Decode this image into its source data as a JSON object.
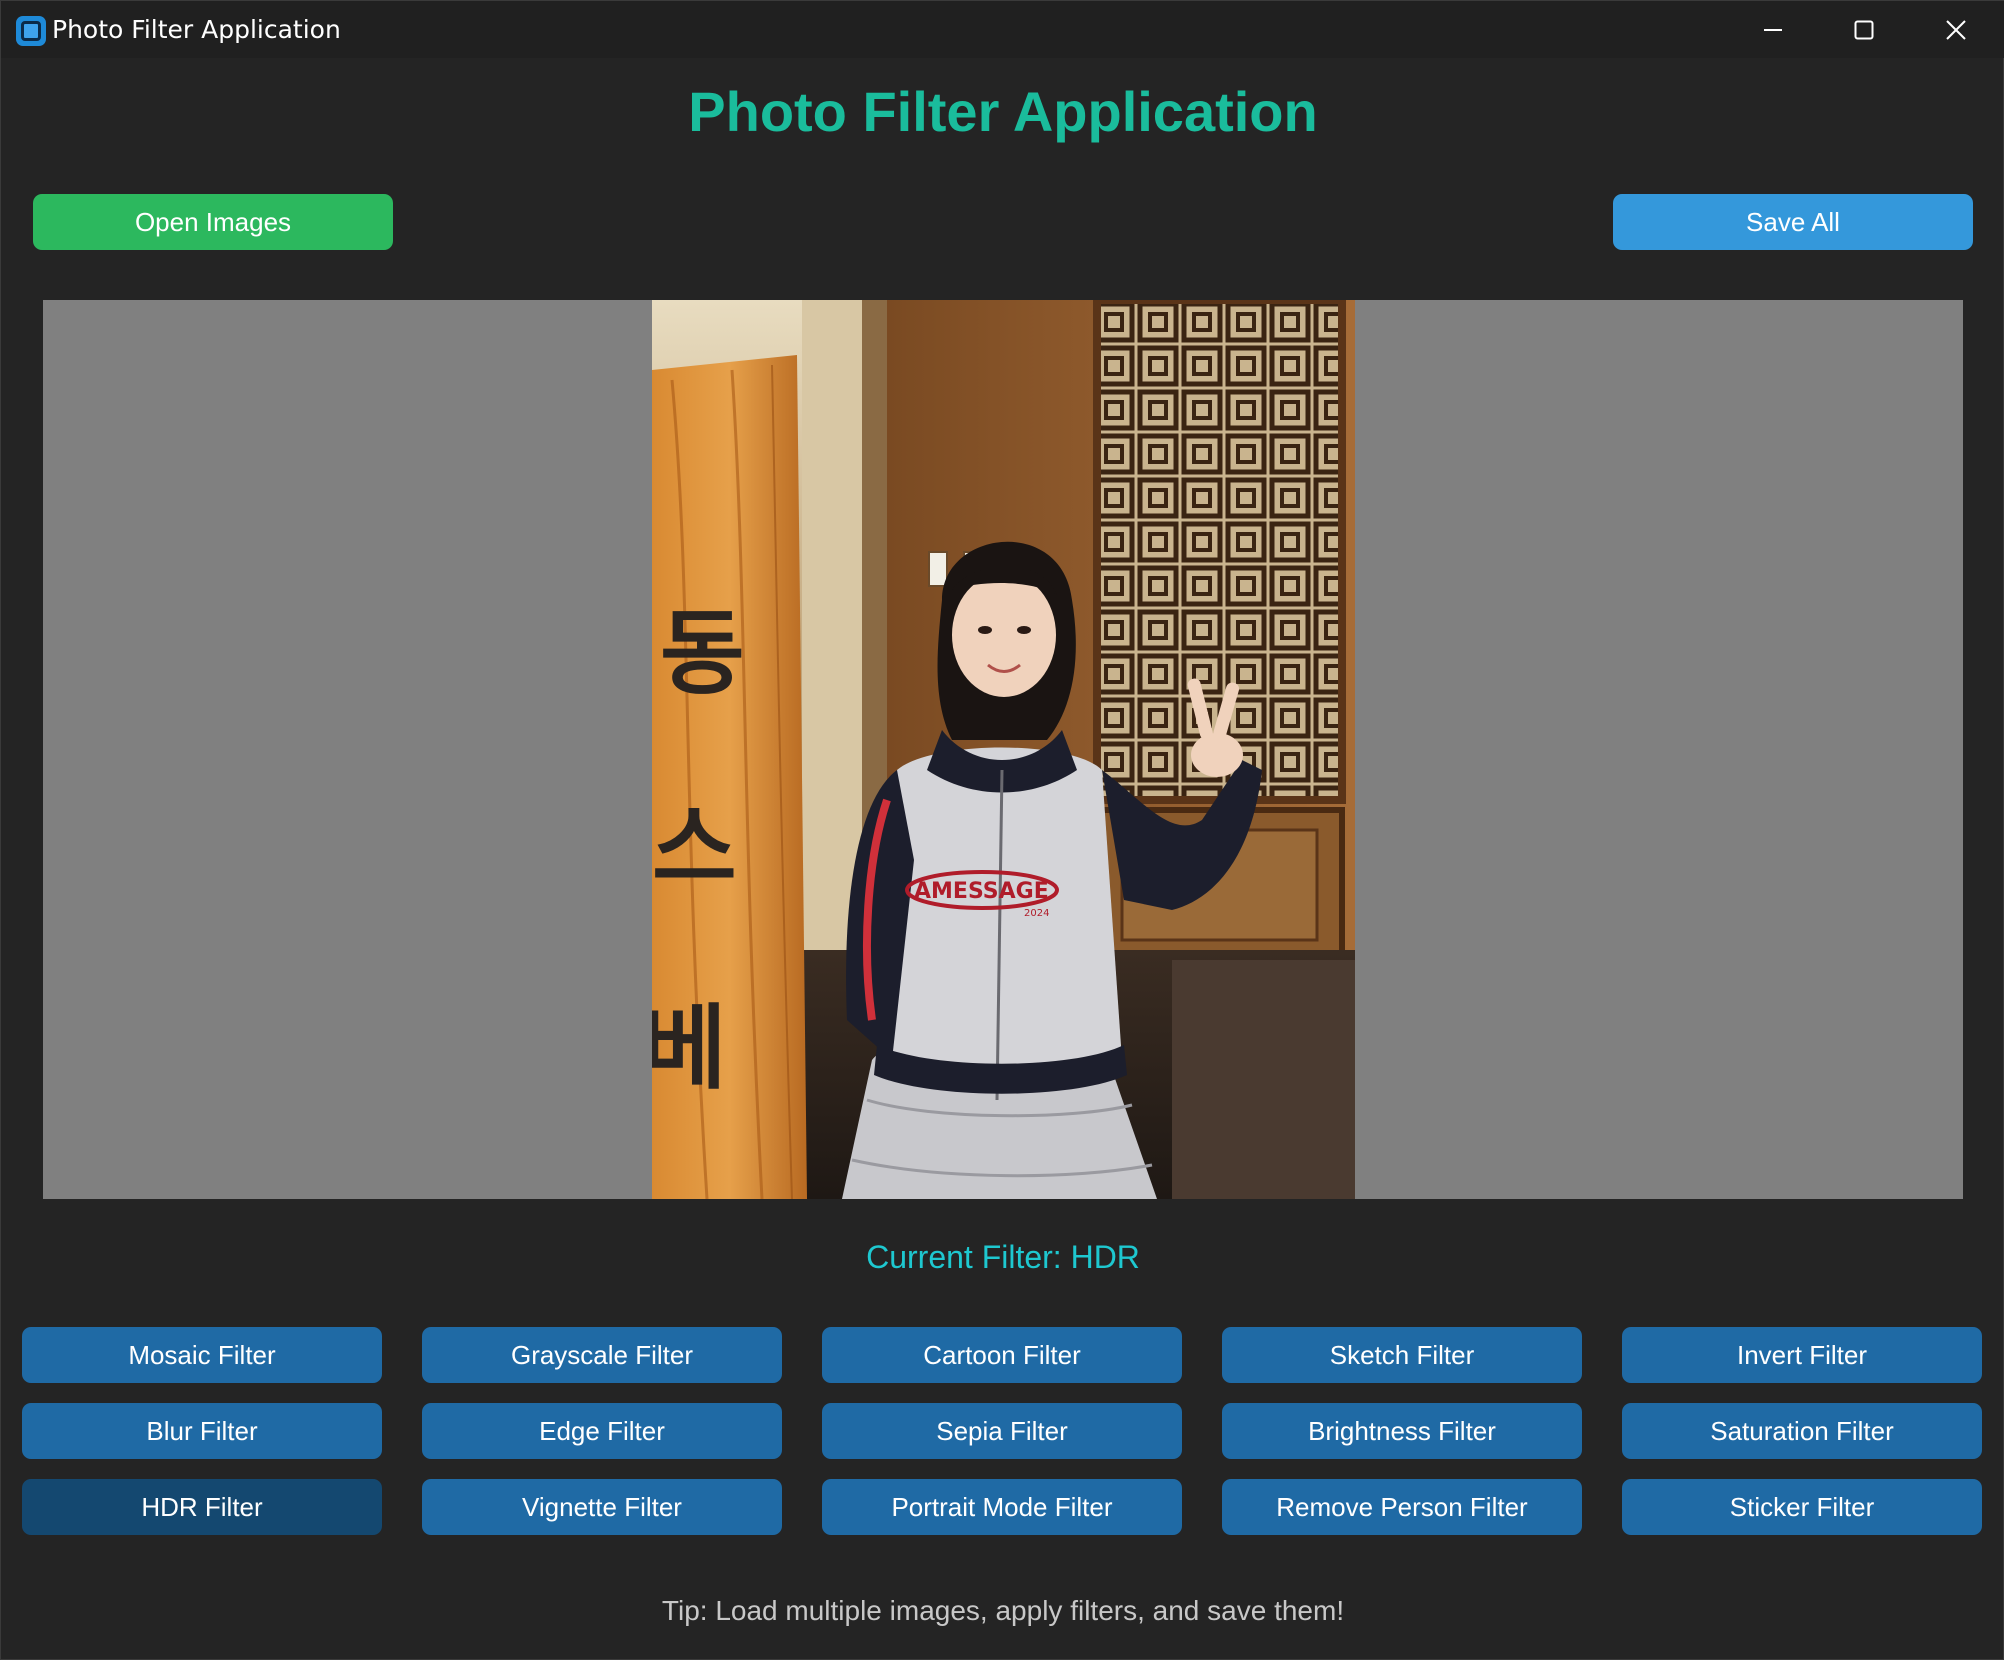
{
  "window": {
    "title": "Photo Filter Application"
  },
  "header": {
    "title": "Photo Filter Application"
  },
  "toolbar": {
    "open_label": "Open Images",
    "save_label": "Save All"
  },
  "canvas": {
    "sign_char_1": "동",
    "sign_char_2": "스",
    "sign_char_3": "베",
    "jacket_text": "AMESSAGE",
    "jacket_year": "2024"
  },
  "status": {
    "current_filter": "Current Filter: HDR"
  },
  "filters": [
    {
      "label": "Mosaic Filter"
    },
    {
      "label": "Grayscale Filter"
    },
    {
      "label": "Cartoon Filter"
    },
    {
      "label": "Sketch Filter"
    },
    {
      "label": "Invert Filter"
    },
    {
      "label": "Blur Filter"
    },
    {
      "label": "Edge Filter"
    },
    {
      "label": "Sepia Filter"
    },
    {
      "label": "Brightness Filter"
    },
    {
      "label": "Saturation Filter"
    },
    {
      "label": "HDR Filter",
      "active": true
    },
    {
      "label": "Vignette Filter"
    },
    {
      "label": "Portrait Mode Filter"
    },
    {
      "label": "Remove Person Filter"
    },
    {
      "label": "Sticker Filter"
    }
  ],
  "footer": {
    "tip": "Tip: Load multiple images, apply filters, and save them!"
  },
  "colors": {
    "background": "#242424",
    "heading": "#1abc9c",
    "open_button": "#2cb85e",
    "save_button": "#3498db",
    "filter_button": "#1f6aa5",
    "filter_button_active": "#144870",
    "status_text": "#1ec8d0",
    "canvas_bg": "#808080"
  },
  "icons": {
    "app": "app-icon",
    "minimize": "minimize-icon",
    "maximize": "maximize-icon",
    "close": "close-icon"
  }
}
